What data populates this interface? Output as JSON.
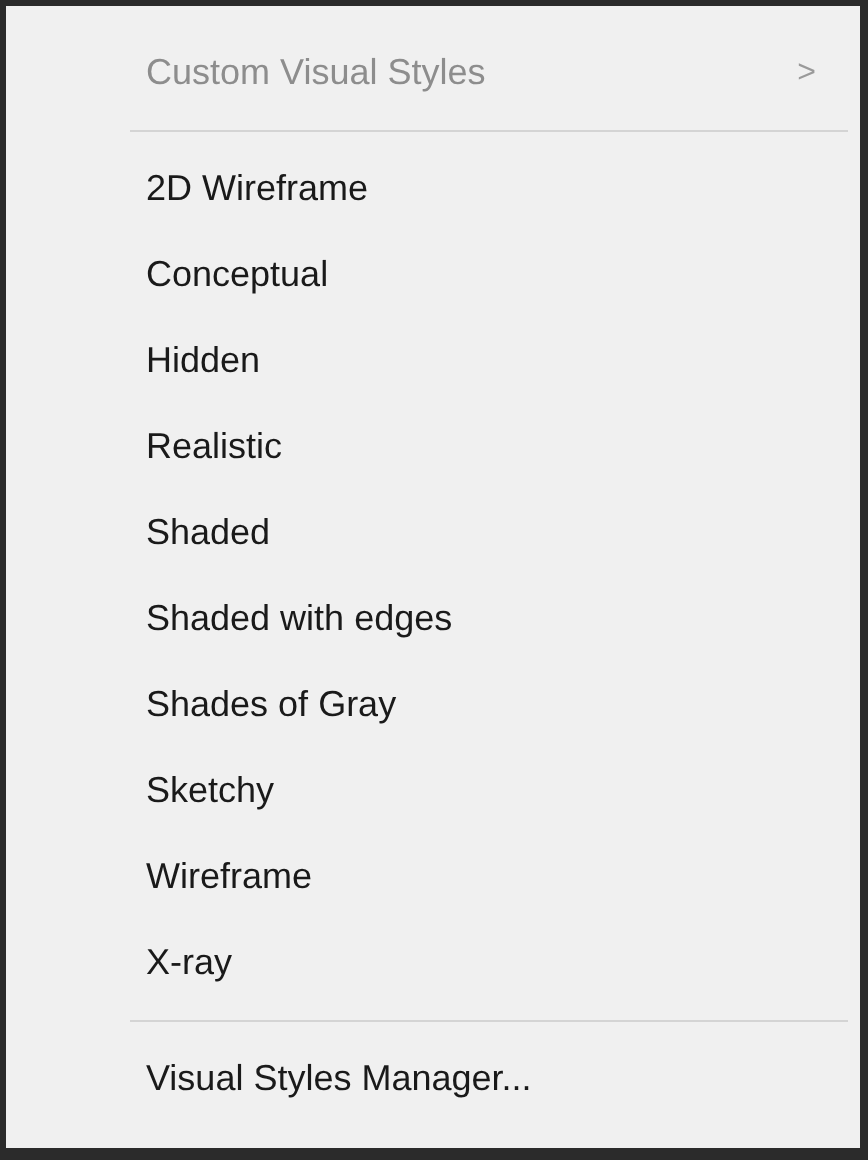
{
  "menu": {
    "items": [
      {
        "kind": "submenu",
        "label": "Custom Visual Styles",
        "arrow": ">",
        "disabled": true
      },
      {
        "kind": "separator"
      },
      {
        "kind": "command",
        "label": "2D Wireframe",
        "disabled": false
      },
      {
        "kind": "command",
        "label": "Conceptual",
        "disabled": false
      },
      {
        "kind": "command",
        "label": "Hidden",
        "disabled": false
      },
      {
        "kind": "command",
        "label": "Realistic",
        "disabled": false
      },
      {
        "kind": "command",
        "label": "Shaded",
        "disabled": false
      },
      {
        "kind": "command",
        "label": "Shaded with edges",
        "disabled": false
      },
      {
        "kind": "command",
        "label": "Shades of Gray",
        "disabled": false
      },
      {
        "kind": "command",
        "label": "Sketchy",
        "disabled": false
      },
      {
        "kind": "command",
        "label": "Wireframe",
        "disabled": false
      },
      {
        "kind": "command",
        "label": "X-ray",
        "disabled": false
      },
      {
        "kind": "separator"
      },
      {
        "kind": "command",
        "label": "Visual Styles Manager...",
        "disabled": false
      }
    ]
  }
}
